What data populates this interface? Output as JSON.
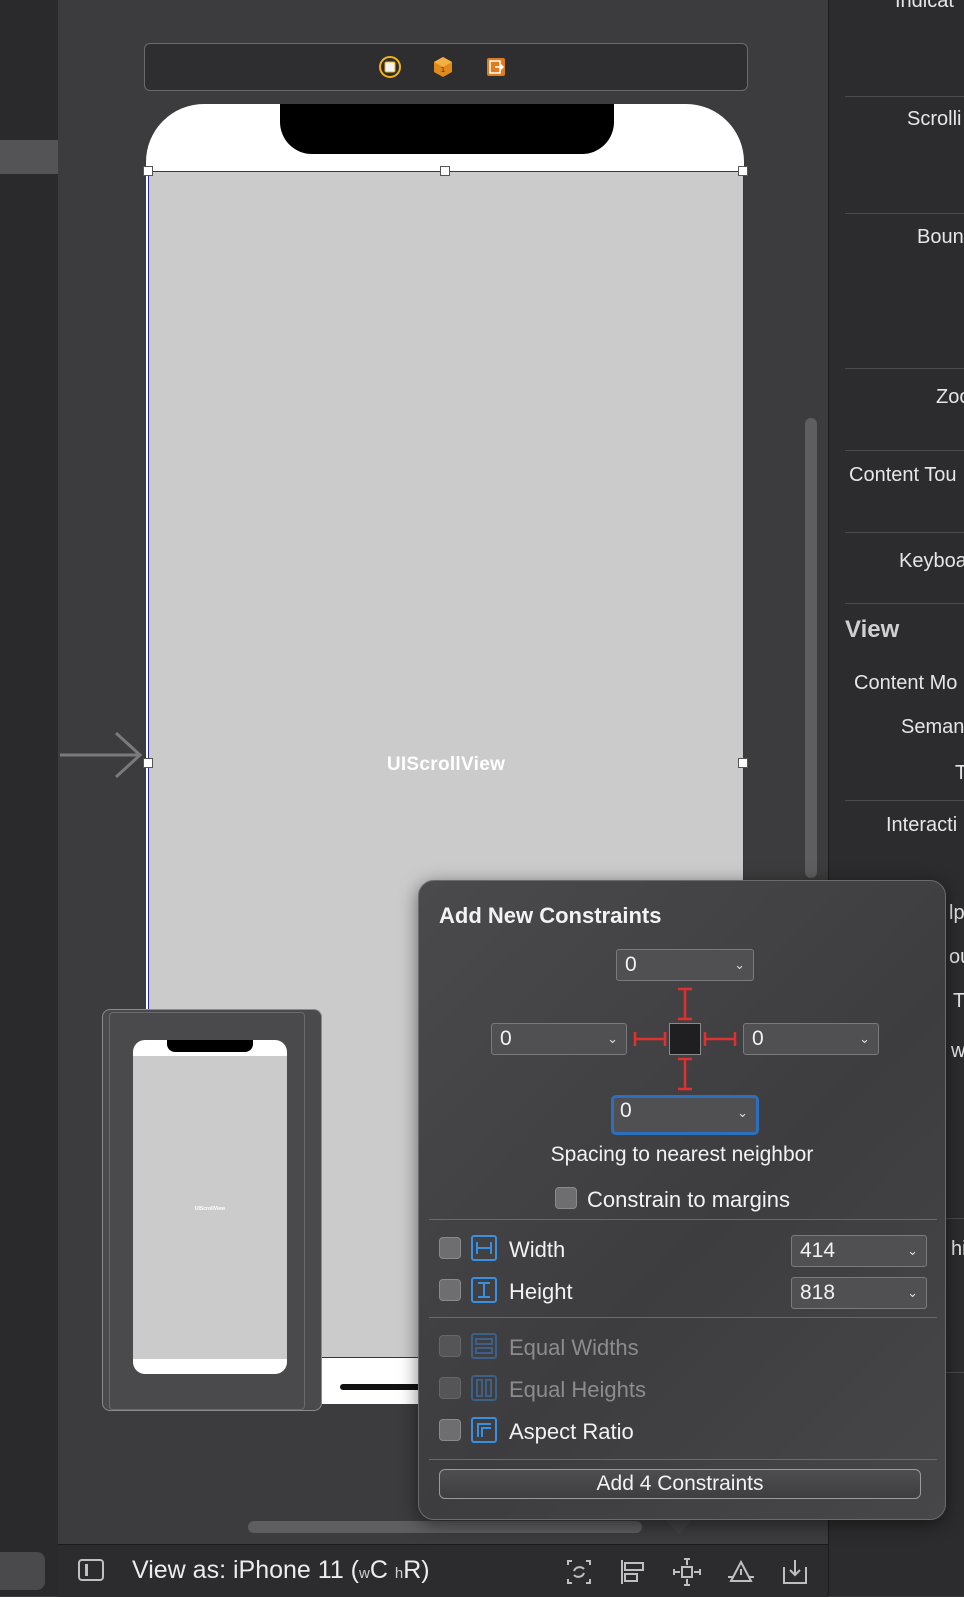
{
  "canvas": {
    "scroll_view_label": "UIScrollView",
    "minimap_label": "UIScrollView"
  },
  "bottom_bar": {
    "view_as_prefix": "View as: iPhone 11 (",
    "size_class_w": "w",
    "size_class_w_value": "C",
    "size_class_h": "h",
    "size_class_h_value": "R",
    "view_as_suffix": ")"
  },
  "inspector": {
    "labels": [
      "Indicat",
      "Scrolli",
      "Boun",
      "Zoo",
      "Content Tou",
      "Keyboa",
      "Content Mo",
      "Seman",
      "T",
      "Interacti",
      "lp",
      "ou",
      "T",
      "wi",
      "hi"
    ],
    "section_view": "View"
  },
  "popover": {
    "title": "Add New Constraints",
    "top_value": "0",
    "left_value": "0",
    "right_value": "0",
    "bottom_value": "0",
    "spacing_label": "Spacing to nearest neighbor",
    "constrain_margins_label": "Constrain to margins",
    "width_label": "Width",
    "width_value": "414",
    "height_label": "Height",
    "height_value": "818",
    "equal_widths_label": "Equal Widths",
    "equal_heights_label": "Equal Heights",
    "aspect_ratio_label": "Aspect Ratio",
    "add_button_label": "Add 4 Constraints"
  },
  "colors": {
    "constraint_red": "#e03030",
    "accent_blue": "#3a8fe0"
  }
}
